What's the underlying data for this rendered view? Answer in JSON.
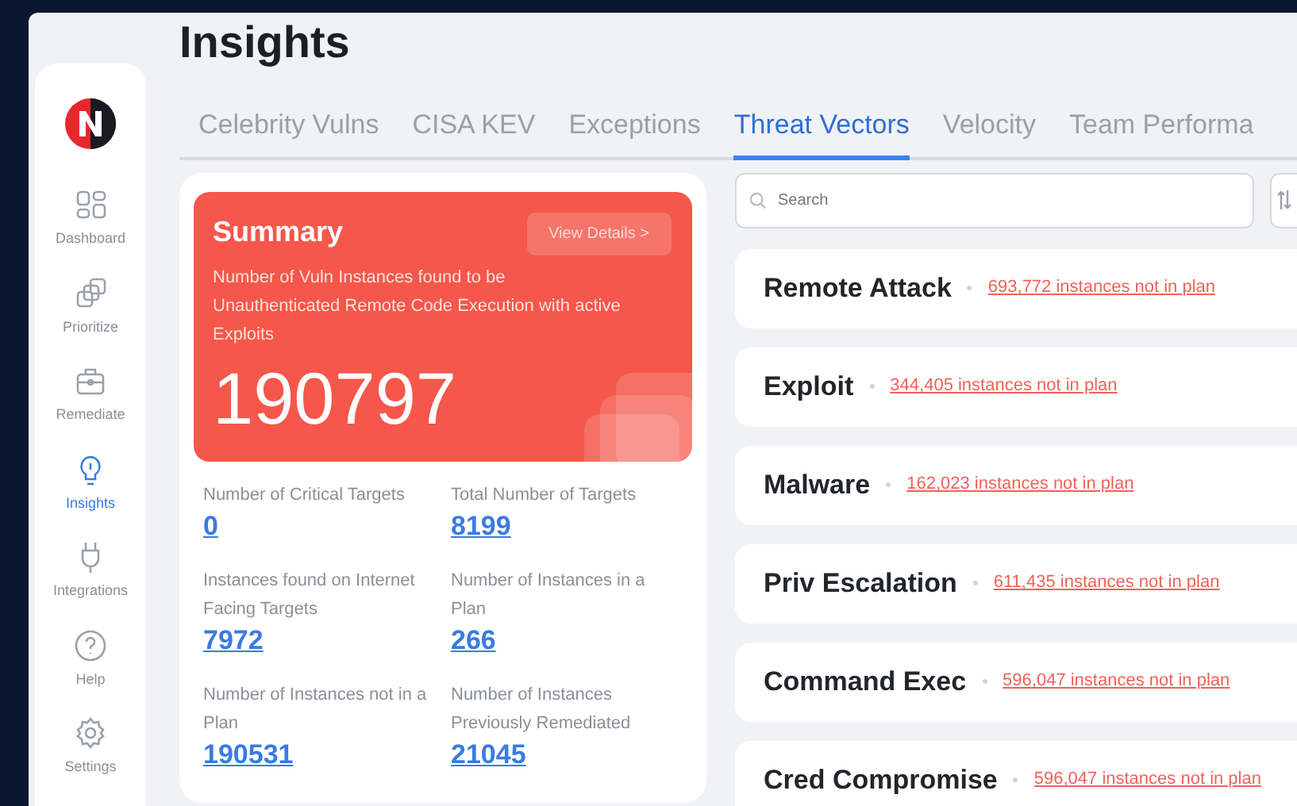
{
  "page": {
    "title": "Insights"
  },
  "sidebar": {
    "items": [
      {
        "label": "Dashboard",
        "selected": false
      },
      {
        "label": "Prioritize",
        "selected": false
      },
      {
        "label": "Remediate",
        "selected": false
      },
      {
        "label": "Insights",
        "selected": true
      },
      {
        "label": "Integrations",
        "selected": false
      },
      {
        "label": "Help",
        "selected": false
      },
      {
        "label": "Settings",
        "selected": false
      }
    ]
  },
  "tabs": [
    {
      "label": "Celebrity Vulns",
      "selected": false
    },
    {
      "label": "CISA KEV",
      "selected": false
    },
    {
      "label": "Exceptions",
      "selected": false
    },
    {
      "label": "Threat Vectors",
      "selected": true
    },
    {
      "label": "Velocity",
      "selected": false
    },
    {
      "label": "Team Performa",
      "selected": false
    }
  ],
  "summary": {
    "title": "Summary",
    "button": "View Details >",
    "description": "Number of Vuln Instances found to be Unauthenticated Remote Code Execution with active Exploits",
    "value": "190797",
    "stats": [
      {
        "label": "Number of Critical Targets",
        "value": "0"
      },
      {
        "label": "Total Number of Targets",
        "value": "8199"
      },
      {
        "label": "Instances found on Internet Facing Targets",
        "value": "7972"
      },
      {
        "label": "Number of Instances in a Plan",
        "value": "266"
      },
      {
        "label": "Number of Instances not in a Plan",
        "value": "190531"
      },
      {
        "label": "Number of Instances Previously Remediated",
        "value": "21045"
      }
    ]
  },
  "search": {
    "placeholder": "Search"
  },
  "vectors": [
    {
      "name": "Remote Attack",
      "link": "693,772 instances not in plan"
    },
    {
      "name": "Exploit",
      "link": "344,405 instances not in plan"
    },
    {
      "name": "Malware",
      "link": "162,023 instances not in plan"
    },
    {
      "name": "Priv Escalation",
      "link": "611,435 instances not in plan"
    },
    {
      "name": "Command Exec",
      "link": "596,047 instances not in plan"
    },
    {
      "name": "Cred Compromise",
      "link": "596,047 instances not in plan"
    }
  ]
}
